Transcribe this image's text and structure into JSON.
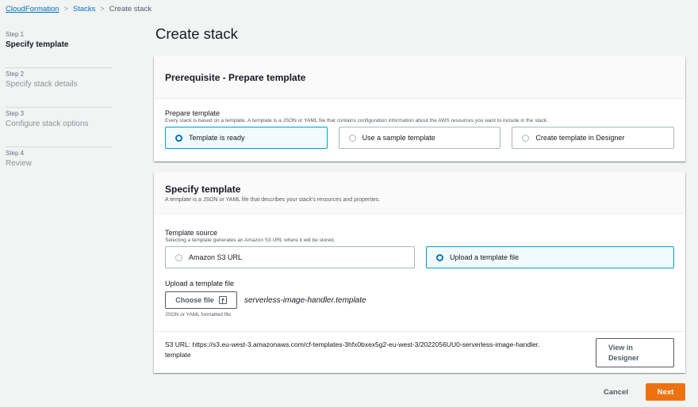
{
  "breadcrumb": {
    "items": [
      "CloudFormation",
      "Stacks"
    ],
    "current": "Create stack",
    "separator": ">"
  },
  "steps": [
    {
      "number": "Step 1",
      "title": "Specify template"
    },
    {
      "number": "Step 2",
      "title": "Specify stack details"
    },
    {
      "number": "Step 3",
      "title": "Configure stack options"
    },
    {
      "number": "Step 4",
      "title": "Review"
    }
  ],
  "page_title": "Create stack",
  "prerequisite": {
    "title": "Prerequisite - Prepare template",
    "field_label": "Prepare template",
    "field_desc": "Every stack is based on a template. A template is a JSON or YAML file that contains configuration information about the AWS resources you want to include in the stack.",
    "options": [
      "Template is ready",
      "Use a sample template",
      "Create template in Designer"
    ],
    "selected": "Template is ready"
  },
  "specify": {
    "title": "Specify template",
    "desc": "A template is a JSON or YAML file that describes your stack's resources and properties.",
    "source_label": "Template source",
    "source_desc": "Selecting a template generates an Amazon S3 URL where it will be stored.",
    "source_options": [
      "Amazon S3 URL",
      "Upload a template file"
    ],
    "source_selected": "Upload a template file",
    "upload_label": "Upload a template file",
    "choose_file": "Choose file",
    "file_name": "serverless-image-handler.template",
    "file_hint": "JSON or YAML formatted file",
    "s3_url_label": "S3 URL:",
    "s3_url_line1": "https://s3.eu-west-3.amazonaws.com/cf-templates-3hfx0bxex5g2-eu-west-3/2022056UU0-serverless-image-handler.",
    "s3_url_line2": "template",
    "view_designer": "View in Designer"
  },
  "footer": {
    "cancel": "Cancel",
    "next": "Next"
  },
  "colors": {
    "accent": "#0073bb",
    "primary": "#ec7211",
    "selected_bg": "#f1faff",
    "selected_border": "#00a1c9"
  }
}
